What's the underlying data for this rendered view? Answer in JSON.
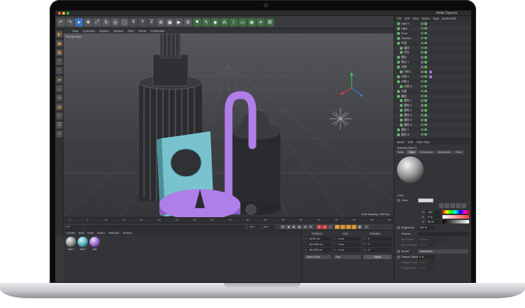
{
  "window": {
    "title": "Node Spaces"
  },
  "menubar": {
    "colors": {
      "close": "#ff5f57",
      "minimize": "#febc2e",
      "zoom": "#28c840"
    }
  },
  "toolbar": {
    "icons": [
      "undo-icon",
      "redo-icon",
      "select-icon",
      "move-icon",
      "scale-icon",
      "rotate-icon",
      "live-select-icon",
      "object-icon",
      "x-axis-icon",
      "y-axis-icon",
      "z-axis-icon",
      "coord-icon",
      "render-view-icon",
      "render-icon",
      "render-settings-icon",
      "cube-icon",
      "pen-icon",
      "subdivision-icon",
      "cloner-icon",
      "deformer-icon",
      "floor-icon",
      "camera-icon",
      "light-icon",
      "python-icon"
    ]
  },
  "view_menu": {
    "items": [
      "View",
      "Cameras",
      "Display",
      "Options",
      "Filter",
      "Panel",
      "ProRender"
    ]
  },
  "viewport": {
    "label": "Perspective",
    "grid_spacing": "Grid Spacing : 500 cm"
  },
  "timeline": {
    "ticks": [
      "0",
      "5",
      "10",
      "15",
      "20",
      "25",
      "30",
      "35",
      "40",
      "45",
      "50",
      "55",
      "60",
      "65",
      "70",
      "75",
      "80",
      "85",
      "90"
    ],
    "current": "0 F",
    "start": "0 F",
    "end": "90 F",
    "end_alt": "90 F"
  },
  "material_manager": {
    "menu": [
      "Create",
      "Edit",
      "View",
      "Select",
      "Material",
      "Texture"
    ],
    "materials": [
      {
        "name": "Mat.3",
        "color": "#9a9a9a"
      },
      {
        "name": "Mat.2",
        "color": "#5fb8c9"
      },
      {
        "name": "Mat",
        "color": "#a572d6"
      }
    ]
  },
  "coordinates": {
    "headers": {
      "position": "Position",
      "size": "Size",
      "rotation": "Rotation"
    },
    "rows": [
      {
        "axis": "X",
        "pos": "24.92 cm",
        "size_axis": "X",
        "size": "0 cm",
        "rot_axis": "H",
        "rot": "0 °"
      },
      {
        "axis": "Y",
        "pos": "101.895 cm",
        "size_axis": "Y",
        "size": "0 cm",
        "rot_axis": "P",
        "rot": "0 °"
      },
      {
        "axis": "Z",
        "pos": "-50.334 cm",
        "size_axis": "Z",
        "size": "0 cm",
        "rot_axis": "B",
        "rot": "0 °"
      }
    ],
    "mode": "Object (Rel)",
    "size_mode": "Size",
    "apply": "Apply"
  },
  "object_manager": {
    "menu": [
      "File",
      "Edit",
      "View",
      "Object",
      "Tags",
      "Bookmarks"
    ],
    "rows": [
      {
        "name": "Light.1",
        "indent": 0,
        "tag": ""
      },
      {
        "name": "Light",
        "indent": 0,
        "tag": ""
      },
      {
        "name": "Floor",
        "indent": 0,
        "tag": ""
      },
      {
        "name": "Camera",
        "indent": 0,
        "tag": ""
      },
      {
        "name": "中国",
        "indent": 0,
        "tag": ""
      },
      {
        "name": "圆环",
        "indent": 1,
        "tag": ""
      },
      {
        "name": "挤压",
        "indent": 1,
        "tag": ""
      },
      {
        "name": "细分",
        "indent": 0,
        "tag": ""
      },
      {
        "name": "细分.1",
        "indent": 0,
        "tag": ""
      },
      {
        "name": "对称",
        "indent": 0,
        "tag": ""
      },
      {
        "name": "对称.1",
        "indent": 1,
        "tag": "#a572d6"
      },
      {
        "name": "对称.1",
        "indent": 0,
        "tag": "#a572d6"
      },
      {
        "name": "对称.2",
        "indent": 0,
        "tag": ""
      },
      {
        "name": "对称.3",
        "indent": 1,
        "tag": ""
      },
      {
        "name": "克隆",
        "indent": 0,
        "tag": ""
      },
      {
        "name": "圆柱",
        "indent": 0,
        "tag": ""
      },
      {
        "name": "圆柱.1",
        "indent": 1,
        "tag": ""
      },
      {
        "name": "圆柱.2",
        "indent": 1,
        "tag": ""
      },
      {
        "name": "圆柱.3",
        "indent": 1,
        "tag": ""
      },
      {
        "name": "圆柱.4",
        "indent": 1,
        "tag": ""
      },
      {
        "name": "圆柱.5",
        "indent": 1,
        "tag": ""
      },
      {
        "name": "圆柱.6",
        "indent": 1,
        "tag": ""
      },
      {
        "name": "圆柱.7",
        "indent": 0,
        "tag": ""
      },
      {
        "name": "圆柱.8",
        "indent": 0,
        "tag": ""
      }
    ]
  },
  "attribute_manager": {
    "menu": [
      "Mode",
      "Edit",
      "User Data"
    ],
    "title": "Material [Mat.3]",
    "tabs": [
      "Basic",
      "Color",
      "Reflectance",
      "Illumination",
      "Editor"
    ],
    "active_tab": "Color",
    "section": "Color",
    "color_label": "Color",
    "h_value": "180 °",
    "s_value": "0 %",
    "v_value": "80 %",
    "brightness_label": "Brightness",
    "brightness_value": "100 %",
    "texture_label": "Texture",
    "mix_mode_label": "Mix Mode",
    "mix_mode_value": "Normal",
    "mix_strength_label": "Mix Strength",
    "mix_strength_value": "100 %",
    "model_label": "Model",
    "model_value": "Lambertian",
    "diffuse_falloff_label": "Diffuse Falloff",
    "diffuse_falloff_value": "0 %",
    "diffuse_level_label": "Diffuse Level",
    "diffuse_level_value": "100 %",
    "roughness_label": "Roughness",
    "roughness_value": "50 %"
  }
}
